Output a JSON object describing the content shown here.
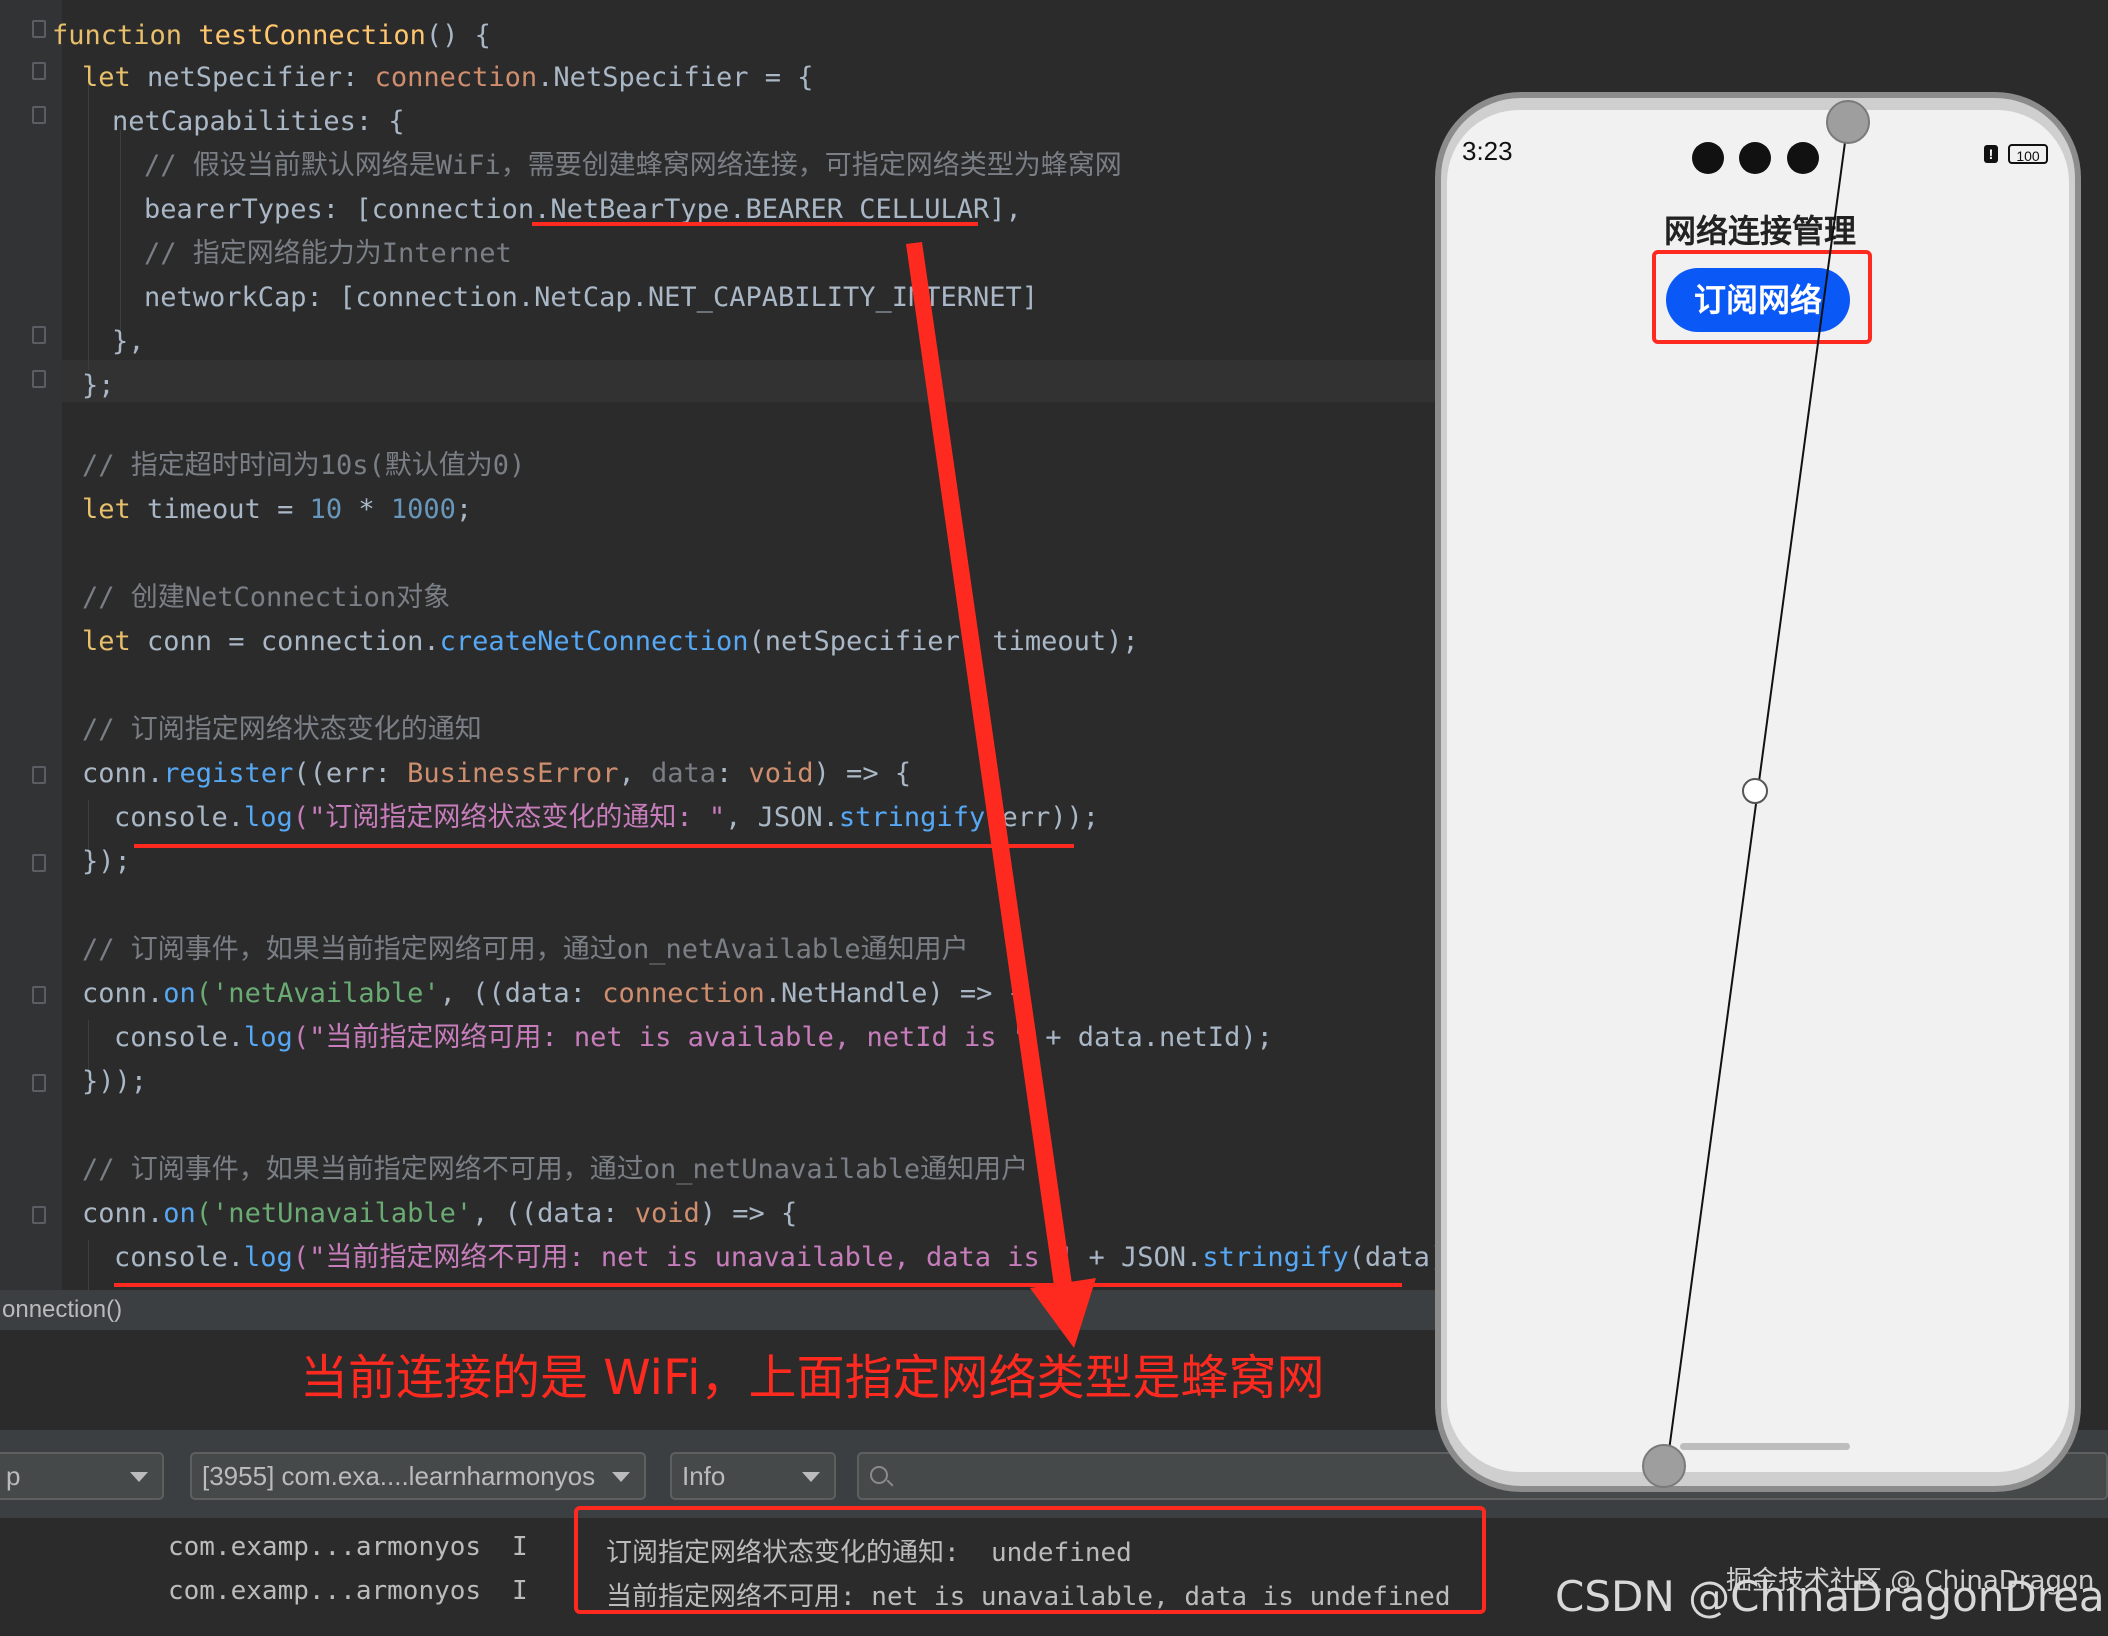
{
  "editor": {
    "lines": [
      {
        "id": "l1",
        "parts": [
          [
            "kw2",
            "function "
          ],
          [
            "fn",
            "testConnection"
          ],
          [
            "prop",
            "() {"
          ]
        ]
      },
      {
        "id": "l2",
        "parts": [
          [
            "kw2",
            "let "
          ],
          [
            "prop",
            "netSpecifier: "
          ],
          [
            "typ",
            "connection"
          ],
          [
            "prop",
            ".NetSpecifier = {"
          ]
        ]
      },
      {
        "id": "l3",
        "parts": [
          [
            "prop",
            "netCapabilities: {"
          ]
        ]
      },
      {
        "id": "l4",
        "parts": [
          [
            "cm",
            "// 假设当前默认网络是WiFi，需要创建蜂窝网络连接，可指定网络类型为蜂窝网"
          ]
        ]
      },
      {
        "id": "l5",
        "parts": [
          [
            "prop",
            "bearerTypes: [connection.NetBearType.BEARER_CELLULAR],"
          ]
        ]
      },
      {
        "id": "l6",
        "parts": [
          [
            "cm",
            "// 指定网络能力为Internet"
          ]
        ]
      },
      {
        "id": "l7",
        "parts": [
          [
            "prop",
            "networkCap: [connection.NetCap.NET_CAPABILITY_INTERNET]"
          ]
        ]
      },
      {
        "id": "l8",
        "parts": [
          [
            "prop",
            "},"
          ]
        ]
      },
      {
        "id": "l9",
        "parts": [
          [
            "prop",
            "};"
          ]
        ]
      },
      {
        "id": "l10",
        "parts": [
          [
            "cm",
            "// 指定超时时间为10s(默认值为0)"
          ]
        ]
      },
      {
        "id": "l11",
        "parts": [
          [
            "kw2",
            "let "
          ],
          [
            "prop",
            "timeout = "
          ],
          [
            "num",
            "10"
          ],
          [
            "prop",
            " * "
          ],
          [
            "num",
            "1000"
          ],
          [
            "prop",
            ";"
          ]
        ]
      },
      {
        "id": "l12",
        "parts": [
          [
            "cm",
            "// 创建NetConnection对象"
          ]
        ]
      },
      {
        "id": "l13",
        "parts": [
          [
            "kw2",
            "let "
          ],
          [
            "prop",
            "conn = connection."
          ],
          [
            "fnb",
            "createNetConnection"
          ],
          [
            "prop",
            "(netSpecifier, timeout);"
          ]
        ]
      },
      {
        "id": "l14",
        "parts": [
          [
            "cm",
            "// 订阅指定网络状态变化的通知"
          ]
        ]
      },
      {
        "id": "l15",
        "parts": [
          [
            "prop",
            "conn."
          ],
          [
            "fnb",
            "register"
          ],
          [
            "prop",
            "((err: "
          ],
          [
            "typ",
            "BusinessError"
          ],
          [
            "prop",
            ", "
          ],
          [
            "cm",
            "data"
          ],
          [
            "prop",
            ": "
          ],
          [
            "typ",
            "void"
          ],
          [
            "prop",
            ") => {"
          ]
        ]
      },
      {
        "id": "l16",
        "parts": [
          [
            "prop",
            "console."
          ],
          [
            "fnb",
            "log"
          ],
          [
            "str",
            "(\"订阅指定网络状态变化的通知: \""
          ],
          [
            "prop",
            ", JSON."
          ],
          [
            "fnb",
            "stringify"
          ],
          [
            "prop",
            "(err));"
          ]
        ]
      },
      {
        "id": "l17",
        "parts": [
          [
            "prop",
            "});"
          ]
        ]
      },
      {
        "id": "l18",
        "parts": [
          [
            "cm",
            "// 订阅事件，如果当前指定网络可用，通过on_netAvailable通知用户"
          ]
        ]
      },
      {
        "id": "l19",
        "parts": [
          [
            "prop",
            "conn."
          ],
          [
            "fnb",
            "on"
          ],
          [
            "str2",
            "('netAvailable'"
          ],
          [
            "prop",
            ", ((data: "
          ],
          [
            "typ",
            "connection"
          ],
          [
            "prop",
            ".NetHandle) => {"
          ]
        ]
      },
      {
        "id": "l20",
        "parts": [
          [
            "prop",
            "console."
          ],
          [
            "fnb",
            "log"
          ],
          [
            "str",
            "(\"当前指定网络可用: net is available, netId is \""
          ],
          [
            "prop",
            " + data.netId);"
          ]
        ]
      },
      {
        "id": "l21",
        "parts": [
          [
            "prop",
            "}));"
          ]
        ]
      },
      {
        "id": "l22",
        "parts": [
          [
            "cm",
            "// 订阅事件，如果当前指定网络不可用，通过on_netUnavailable通知用户"
          ]
        ]
      },
      {
        "id": "l23",
        "parts": [
          [
            "prop",
            "conn."
          ],
          [
            "fnb",
            "on"
          ],
          [
            "str2",
            "('netUnavailable'"
          ],
          [
            "prop",
            ", ((data: "
          ],
          [
            "typ",
            "void"
          ],
          [
            "prop",
            ") => {"
          ]
        ]
      },
      {
        "id": "l24",
        "parts": [
          [
            "prop",
            "console."
          ],
          [
            "fnb",
            "log"
          ],
          [
            "str",
            "(\"当前指定网络不可用: net is unavailable, data is \""
          ],
          [
            "prop",
            " + JSON."
          ],
          [
            "fnb",
            "stringify"
          ],
          [
            "prop",
            "(data));"
          ]
        ]
      }
    ]
  },
  "breadcrumb": "onnection()",
  "annotation": "当前连接的是 WiFi，上面指定网络类型是蜂窝网",
  "toolbar": {
    "device_combo": "p",
    "process_combo": "[3955] com.exa....learnharmonyos",
    "level_combo": "Info",
    "search_placeholder": ""
  },
  "logs": [
    {
      "tag": "com.examp...armonyos",
      "level": "I",
      "msg": "订阅指定网络状态变化的通知:  undefined"
    },
    {
      "tag": "com.examp...armonyos",
      "level": "I",
      "msg": "当前指定网络不可用: net is unavailable, data is undefined"
    }
  ],
  "phone": {
    "time": "3:23",
    "battery": "100",
    "battery_alert": "!",
    "app_title": "网络连接管理",
    "subscribe_button": "订阅网络"
  },
  "watermarks": {
    "juejin": "掘金技术社区 @ ChinaDragon",
    "csdn": "CSDN @ChinaDragonDreamer"
  },
  "colors": {
    "annotation_red": "#ff2a1f",
    "button_blue": "#0a59f7",
    "editor_bg": "#2b2b2b"
  }
}
